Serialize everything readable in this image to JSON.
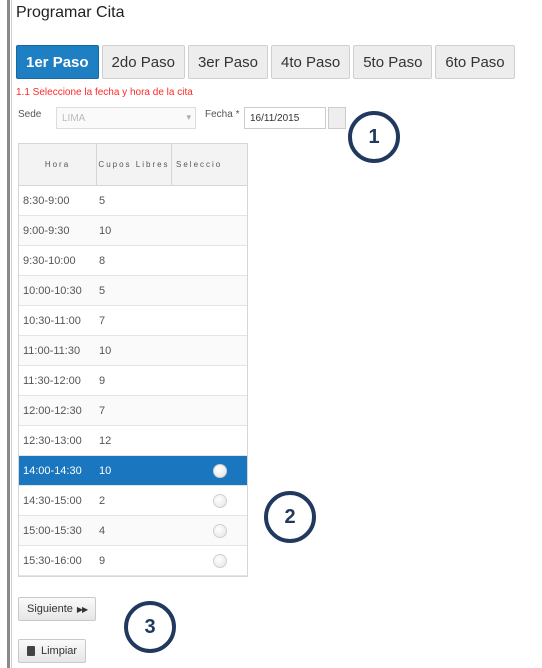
{
  "page": {
    "title": "Programar Cita"
  },
  "tabs": [
    {
      "label": "1er Paso",
      "active": true
    },
    {
      "label": "2do Paso",
      "active": false
    },
    {
      "label": "3er Paso",
      "active": false
    },
    {
      "label": "4to Paso",
      "active": false
    },
    {
      "label": "5to Paso",
      "active": false
    },
    {
      "label": "6to Paso",
      "active": false
    }
  ],
  "hint": "1.1 Seleccione la fecha y hora de la cita",
  "filters": {
    "sede_label": "Sede",
    "sede_value": "LIMA",
    "fecha_label": "Fecha *",
    "fecha_value": "16/11/2015"
  },
  "grid": {
    "headers": {
      "hora": "Hora",
      "cupos": "Cupos Libres",
      "seleccion": "Seleccio"
    },
    "rows": [
      {
        "hora": "8:30-9:00",
        "cupos": "5"
      },
      {
        "hora": "9:00-9:30",
        "cupos": "10"
      },
      {
        "hora": "9:30-10:00",
        "cupos": "8"
      },
      {
        "hora": "10:00-10:30",
        "cupos": "5"
      },
      {
        "hora": "10:30-11:00",
        "cupos": "7"
      },
      {
        "hora": "11:00-11:30",
        "cupos": "10"
      },
      {
        "hora": "11:30-12:00",
        "cupos": "9"
      },
      {
        "hora": "12:00-12:30",
        "cupos": "7"
      },
      {
        "hora": "12:30-13:00",
        "cupos": "12"
      },
      {
        "hora": "14:00-14:30",
        "cupos": "10"
      },
      {
        "hora": "14:30-15:00",
        "cupos": "2"
      },
      {
        "hora": "15:00-15:30",
        "cupos": "4"
      },
      {
        "hora": "15:30-16:00",
        "cupos": "9"
      }
    ],
    "selected_row": 9
  },
  "buttons": {
    "next": "Siguiente",
    "clear": "Limpiar"
  },
  "callouts": [
    "1",
    "2",
    "3"
  ],
  "colors": {
    "accent": "#1e7fc2",
    "selected_row": "#1a76be",
    "hint": "#ff2a2a",
    "callout_border": "#21395e"
  }
}
